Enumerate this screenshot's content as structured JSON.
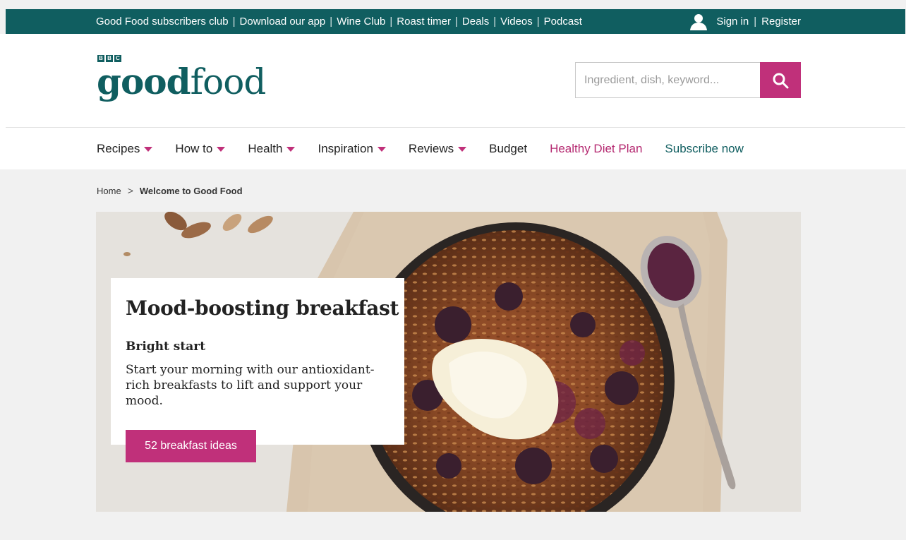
{
  "topbar": {
    "links": [
      "Good Food subscribers club",
      "Download our app",
      "Wine Club",
      "Roast timer",
      "Deals",
      "Videos",
      "Podcast"
    ],
    "separator": "|",
    "sign_in": "Sign in",
    "register": "Register",
    "user_icon": "user-icon"
  },
  "logo": {
    "bbc": [
      "B",
      "B",
      "C"
    ],
    "bold_part": "good",
    "light_part": "food"
  },
  "search": {
    "placeholder": "Ingredient, dish, keyword...",
    "icon": "search-icon"
  },
  "nav": {
    "items": [
      {
        "label": "Recipes",
        "dropdown": true
      },
      {
        "label": "How to",
        "dropdown": true
      },
      {
        "label": "Health",
        "dropdown": true
      },
      {
        "label": "Inspiration",
        "dropdown": true
      },
      {
        "label": "Reviews",
        "dropdown": true
      },
      {
        "label": "Budget",
        "dropdown": false
      },
      {
        "label": "Healthy Diet Plan",
        "dropdown": false
      },
      {
        "label": "Subscribe now",
        "dropdown": false
      }
    ]
  },
  "breadcrumb": {
    "home": "Home",
    "separator": ">",
    "current": "Welcome to Good Food"
  },
  "hero": {
    "title": "Mood-boosting breakfast",
    "subtitle": "Bright start",
    "text": "Start your morning with our antioxidant-rich breakfasts to lift and support your mood.",
    "cta": "52 breakfast ideas"
  },
  "colors": {
    "brand_teal": "#105e60",
    "accent_pink": "#c0307a",
    "page_bg": "#f1f1f1"
  }
}
